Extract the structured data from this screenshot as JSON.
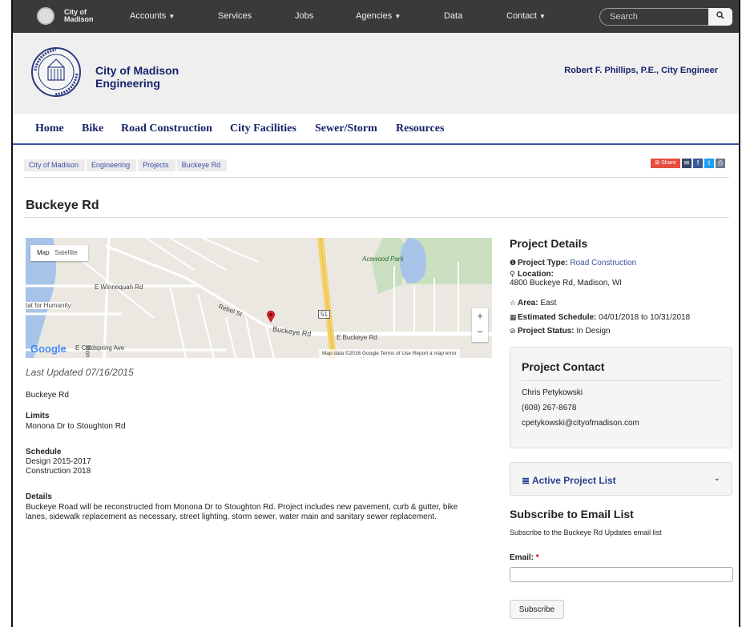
{
  "topnav": {
    "logo_line1": "City of",
    "logo_line2": "Madison",
    "items": [
      "Accounts",
      "Services",
      "Jobs",
      "Agencies",
      "Data",
      "Contact"
    ],
    "search_placeholder": "Search"
  },
  "header": {
    "title_line1": "City of Madison",
    "title_line2": "Engineering",
    "engineer": "Robert F. Phillips, P.E., City Engineer"
  },
  "mainnav": [
    "Home",
    "Bike",
    "Road Construction",
    "City Facilities",
    "Sewer/Storm",
    "Resources"
  ],
  "breadcrumb": [
    "City of Madison",
    "Engineering",
    "Projects",
    "Buckeye Rd"
  ],
  "share_label": "Share",
  "page_title": "Buckeye Rd",
  "map": {
    "type_map": "Map",
    "type_satellite": "Satellite",
    "labels": [
      "E Winnequah Rd",
      "Acewood Park",
      "Buckeye Rd",
      "E Buckeye Rd",
      "E Coldspring Ave",
      "Rebel St",
      "Monona Dr",
      "tat for Humanity"
    ],
    "shield": "51",
    "attribution": "Map data ©2016 Google   Terms of Use   Report a map error",
    "google": "Google"
  },
  "main": {
    "last_updated": "Last Updated 07/16/2015",
    "name": "Buckeye Rd",
    "limits_label": "Limits",
    "limits": "Monona Dr to Stoughton Rd",
    "schedule_label": "Schedule",
    "schedule_1": "Design 2015-2017",
    "schedule_2": "Construction 2018",
    "details_label": "Details",
    "details_1": "Buckeye Road will be reconstructed from Monona Dr to Stoughton Rd.  Project includes new pavement, curb & gutter, bike",
    "details_2": "lanes, sidewalk replacement as necessary, street lighting, storm sewer, water main and sanitary sewer replacement."
  },
  "project_details": {
    "title": "Project Details",
    "type_label": "Project Type:",
    "type_value": "Road Construction",
    "location_label": "Location:",
    "location_value": "4800 Buckeye Rd, Madison, WI",
    "area_label": "Area:",
    "area_value": "East",
    "schedule_label": "Estimated Schedule:",
    "schedule_value": "04/01/2018 to 10/31/2018",
    "status_label": "Project Status:",
    "status_value": "In Design"
  },
  "contact": {
    "title": "Project Contact",
    "name": "Chris Petykowski",
    "phone": "(608) 267-8678",
    "email": "cpetykowski@cityofmadison.com"
  },
  "active_list": "Active Project List",
  "subscribe": {
    "title": "Subscribe to Email List",
    "description": "Subscribe to the Buckeye Rd Updates email list",
    "email_label": "Email:",
    "required": "*",
    "button": "Subscribe"
  }
}
